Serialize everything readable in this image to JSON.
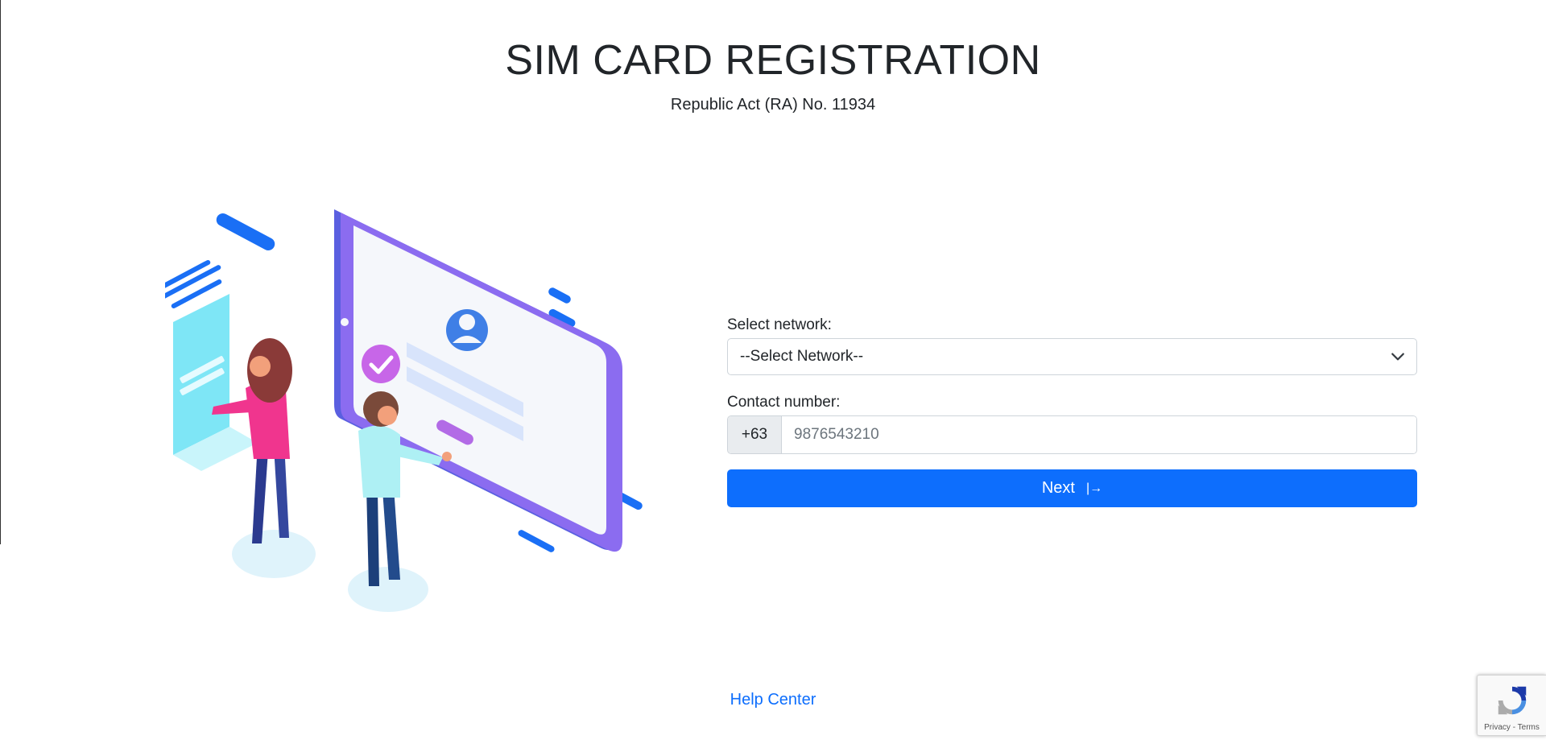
{
  "header": {
    "title": "SIM CARD REGISTRATION",
    "subtitle": "Republic Act (RA) No. 11934"
  },
  "form": {
    "network_label": "Select network:",
    "network_selected": "--Select Network--",
    "contact_label": "Contact number:",
    "country_code": "+63",
    "contact_placeholder": "9876543210",
    "contact_value": "",
    "next_label": "Next",
    "next_icon": "|→"
  },
  "footer": {
    "help_link": "Help Center"
  },
  "recaptcha": {
    "privacy": "Privacy",
    "separator": " - ",
    "terms": "Terms"
  },
  "colors": {
    "primary": "#0d6efd",
    "text": "#212529",
    "border": "#ced4da",
    "addon_bg": "#e9ecef"
  },
  "icons": {
    "select_arrow": "chevron-down-icon",
    "next": "sign-in-arrow-icon",
    "recaptcha": "recaptcha-logo-icon"
  }
}
